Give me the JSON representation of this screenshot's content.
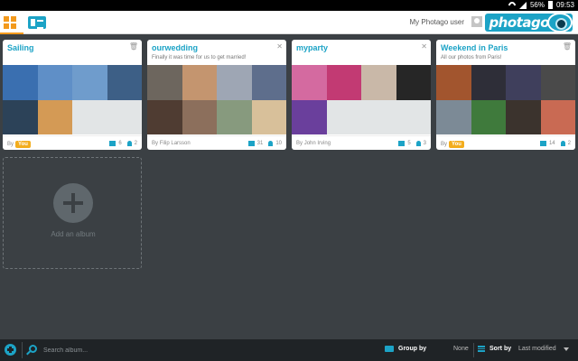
{
  "status_bar": {
    "battery": "56%",
    "time": "09:53"
  },
  "header": {
    "user_name": "My Photago user",
    "logo_text": "photago"
  },
  "albums": [
    {
      "title": "Sailing",
      "subtitle": "",
      "corner_icon": "trash-icon",
      "by_label": "By",
      "owner_badge": "You",
      "owner_name": "",
      "photo_count": "6",
      "member_count": "2",
      "photos": [
        "#3a6fb0",
        "#5f8fc7",
        "#6f9ccc",
        "#3d5f86",
        "#2c4258",
        "#d49a55",
        "#e2e5e6",
        "#e2e5e6"
      ]
    },
    {
      "title": "ourwedding",
      "subtitle": "Finally it was time for us to get married!",
      "corner_icon": "close-icon",
      "by_label": "By",
      "owner_badge": "",
      "owner_name": "Filip Larsson",
      "photo_count": "31",
      "member_count": "10",
      "photos": [
        "#6d665e",
        "#c4956f",
        "#9ea6b4",
        "#5e6e8c",
        "#4f3c32",
        "#8c6f5c",
        "#879a7e",
        "#d8c09a"
      ]
    },
    {
      "title": "myparty",
      "subtitle": "",
      "corner_icon": "close-icon",
      "by_label": "By",
      "owner_badge": "",
      "owner_name": "John Irving",
      "photo_count": "5",
      "member_count": "3",
      "photos": [
        "#d46aa0",
        "#c23a73",
        "#c9b8a8",
        "#262626",
        "#6a3f9c",
        "#e2e5e6",
        "#e2e5e6",
        "#e2e5e6"
      ]
    },
    {
      "title": "Weekend in Paris",
      "subtitle": "All our photos from Paris!",
      "corner_icon": "trash-icon",
      "by_label": "By",
      "owner_badge": "You",
      "owner_name": "",
      "photo_count": "14",
      "member_count": "2",
      "photos": [
        "#a2552e",
        "#2e2e38",
        "#3f3f5c",
        "#4a4a4a",
        "#7c8a96",
        "#3f7a3c",
        "#3b332d",
        "#c96a53"
      ]
    }
  ],
  "add_album": {
    "label": "Add an album"
  },
  "bottom_bar": {
    "search_placeholder": "Search album...",
    "group_by_label": "Group by",
    "group_by_value": "None",
    "sort_by_label": "Sort by",
    "sort_by_value": "Last modified"
  },
  "colors": {
    "accent": "#1ca3c6",
    "badge": "#f3ad1d",
    "background": "#3b4044"
  }
}
